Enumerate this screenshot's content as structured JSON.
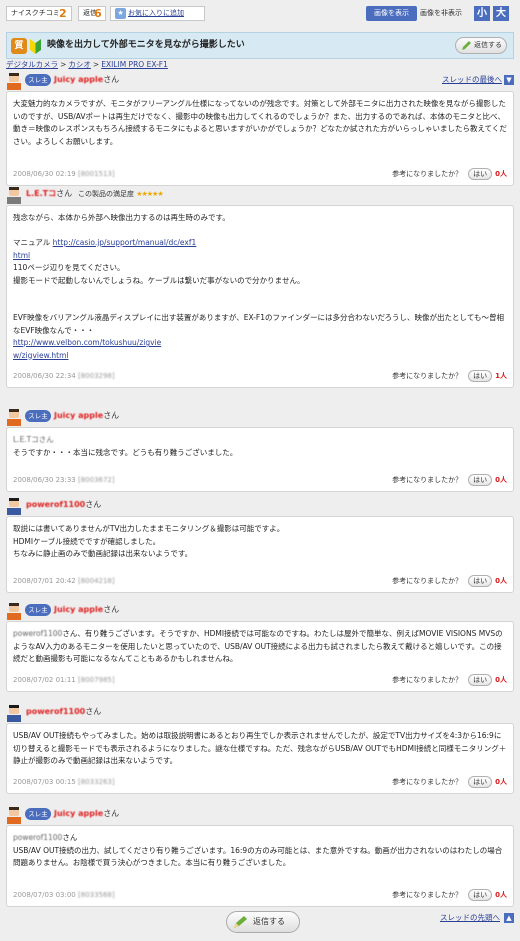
{
  "topbar": {
    "naisu_label": "ナイスクチコミ",
    "naisu_count": "2",
    "henshin_label": "返信",
    "henshin_count": "6",
    "favorite_label": "お気に入りに追加",
    "image_show": "画像を表示",
    "image_hide": "画像を非表示",
    "size_small": "小",
    "size_large": "大"
  },
  "thread": {
    "badge": "質",
    "title": "映像を出力して外部モニタを見ながら撮影したい",
    "reply_label": "返信する"
  },
  "breadcrumb": [
    "デジタルカメラ",
    "カシオ",
    "EXILIM PRO EX-F1"
  ],
  "labels": {
    "sure_badge": "スレ主",
    "san": "さん",
    "to_latest": "スレッドの最後へ",
    "to_top": "スレッドの先頭へ",
    "helpful_q": "参考になりましたか？",
    "hai": "はい",
    "satisfaction": "この製品の満足度",
    "stars": "★★★★★",
    "reply_bottom": "返信する"
  },
  "posts": [
    {
      "author": "Juicy apple",
      "body": "大変魅力的なカメラですが、モニタがフリーアングル仕様になってないのが残念です。対策として外部モニタに出力された映像を見ながら撮影したいのですが、USB/AVポートは再生だけでなく、撮影中の映像も出力してくれるのでしょうか？また、出力するのであれば、本体のモニタと比べ、動き＝映像のレスポンスもちろん接続するモニタにもよると思いますがいかがでしょうか？どなたか試された方がいらっしゃいましたら教えてください。よろしくお願いします。",
      "date": "2008/06/30 02:19",
      "id": "[8001513]",
      "count": "0人"
    },
    {
      "author": "L.E.Tコ",
      "body_lines": [
        "残念ながら、本体から外部へ映像出力するのは再生時のみです。",
        "",
        "マニュアル",
        "110ページ辺りを見てください。",
        "撮影モードで起動しないんでしょうね。ケーブルは繋いだ事がないので分かりません。",
        "",
        "",
        "EVF映像をバリアングル液晶ディスプレイに出す装置がありますが、EX-F1のファインダーには多分合わないだろうし、映像が出たとしても〜曾相なEVF映像なんで・・・"
      ],
      "link1a": "http://casio.jp/support/manual/dc/exf1",
      "link1b": "html",
      "link2a": "http://www.velbon.com/tokushuu/zigvie",
      "link2b": "w/zigview.html",
      "date": "2008/06/30 22:34",
      "id": "[8003298]",
      "count": "1人"
    },
    {
      "author": "Juicy apple",
      "line1": "L.E.Tコさん",
      "line2": "そうですか・・・本当に残念です。どうも有り難うございました。",
      "date": "2008/06/30 23:33",
      "id": "[8003672]",
      "count": "0人"
    },
    {
      "author": "powerof1100",
      "body": "取説には書いてありませんがTV出力したままモニタリング＆撮影は可能ですよ。\nHDMIケーブル接続でですが確認しました。\nちなみに静止画のみで動画記録は出来ないようです。",
      "date": "2008/07/01 20:42",
      "id": "[8004218]",
      "count": "0人"
    },
    {
      "author": "Juicy apple",
      "prefix": "powerof1100",
      "body": "さん、有り難うございます。そうですか、HDMI接続では可能なのですね。わたしは屋外で簡単な、例えばMOVIE VISIONS MVSのようなAV入力のあるモニターを使用したいと思っていたので、USB/AV OUT接続による出力も試されましたら教えて戴けると嬉しいです。この接続だと動画撮影も可能になるなんてこともあるかもしれませんね。",
      "date": "2008/07/02 01:11",
      "id": "[8007985]",
      "count": "0人"
    },
    {
      "author": "powerof1100",
      "body": "USB/AV OUT接続もやってみました。始めは取扱説明書にあるとおり再生でしか表示されませんでしたが、設定でTV出力サイズを4:3から16:9に切り替えると撮影モードでも表示されるようになりました。謎な仕様ですね。ただ、残念ながらUSB/AV OUTでもHDMI接続と同様モニタリング＋静止が撮影のみで動画記録は出来ないようです。",
      "date": "2008/07/03 00:15",
      "id": "[8033263]",
      "count": "0人"
    },
    {
      "author": "Juicy apple",
      "prefix": "powerof1100",
      "body": "USB/AV OUT接続の出力、試してくださり有り難うございます。16:9の方のみ可能とは、また意外ですね。動画が出力されないのはわたしの場合問題ありません。お陰様で買う決心がつきました。本当に有り難うございました。",
      "date": "2008/07/03 03:00",
      "id": "[8033568]",
      "count": "0人"
    }
  ]
}
